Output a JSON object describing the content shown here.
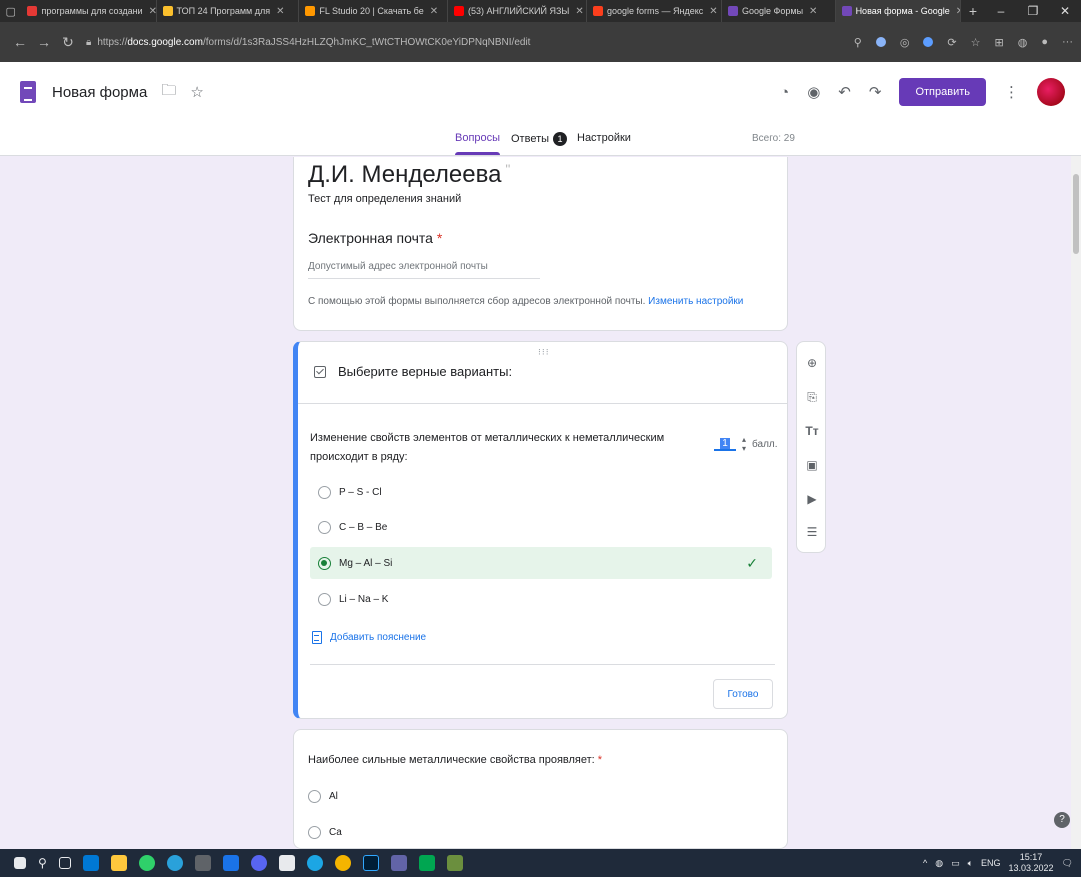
{
  "browser": {
    "tabs": [
      {
        "title": "программы для создани",
        "color": "#e53935"
      },
      {
        "title": "ТОП 24 Программ для",
        "color": "#fbc02d"
      },
      {
        "title": "FL Studio 20 | Скачать бе",
        "color": "#ff9800"
      },
      {
        "title": "(53) АНГЛИЙСКИЙ ЯЗЫ",
        "color": "#ff0000"
      },
      {
        "title": "google forms — Яндекс",
        "color": "#fc3f1d"
      },
      {
        "title": "Google Формы",
        "color": "#7248b9"
      },
      {
        "title": "Новая форма - Google",
        "color": "#7248b9"
      }
    ],
    "url_prefix": "https://",
    "url_domain": "docs.google.com",
    "url_path": "/forms/d/1s3RaJSS4HzHLZQhJmKC_tWtCTHOWtCK0eYiDPNqNBNI/edit"
  },
  "header": {
    "title": "Новая форма",
    "send_label": "Отправить"
  },
  "subtabs": {
    "questions": "Вопросы",
    "answers": "Ответы",
    "answers_badge": "1",
    "settings": "Настройки",
    "total": "Всего: 29"
  },
  "form_header": {
    "title": "Д.И. Менделеева",
    "description": "Тест для определения знаний",
    "email_label": "Электронная почта",
    "email_placeholder": "Допустимый адрес электронной почты",
    "collect_note": "С помощью этой формы выполняется сбор адресов электронной почты.",
    "change_settings": "Изменить настройки"
  },
  "question1": {
    "type_label": "Выберите верные варианты:",
    "text": "Изменение свойств элементов от металлических к неметаллическим происходит в ряду:",
    "points_value": "1",
    "points_label": "балл.",
    "options": [
      "P – S - Cl",
      "C – B – Be",
      "Mg – Al – Si",
      "Li – Na – K"
    ],
    "correct_index": 2,
    "add_explanation": "Добавить пояснение",
    "done_label": "Готово"
  },
  "question2": {
    "text": "Наиболее сильные металлические свойства проявляет:",
    "options": [
      "Al",
      "Ca"
    ]
  },
  "taskbar": {
    "lang": "ENG",
    "time": "15:17",
    "date": "13.03.2022"
  }
}
